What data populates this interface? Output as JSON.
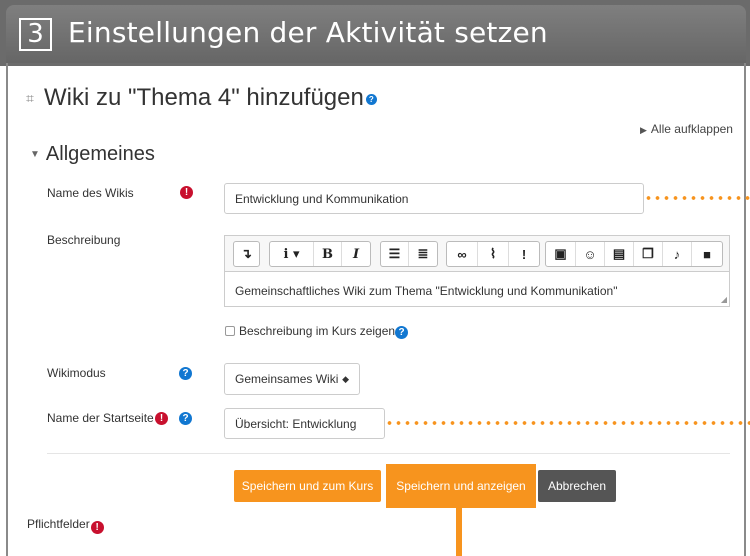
{
  "banner": {
    "step": "3",
    "title": "Einstellungen der Aktivität setzen"
  },
  "page": {
    "title": "Wiki zu \"Thema 4\" hinzufügen",
    "expand_all": "Alle aufklappen",
    "section": "Allgemeines"
  },
  "form": {
    "name": {
      "label": "Name des Wikis",
      "value": "Entwicklung und Kommunikation"
    },
    "description": {
      "label": "Beschreibung",
      "value": "Gemeinschaftliches Wiki zum Thema \"Entwicklung und Kommunikation\""
    },
    "show_description": {
      "label": "Beschreibung im Kurs zeigen",
      "checked": false
    },
    "wikimode": {
      "label": "Wikimodus",
      "value": "Gemeinsames Wiki"
    },
    "startpage": {
      "label": "Name der Startseite",
      "value": "Übersicht: Entwicklung"
    }
  },
  "toolbar": {
    "groups": [
      [
        "collapse-icon"
      ],
      [
        "info-dropdown-icon",
        "bold-icon",
        "italic-icon"
      ],
      [
        "bullet-list-icon",
        "numbered-list-icon"
      ],
      [
        "link-icon",
        "unlink-icon",
        "exclamation-icon"
      ],
      [
        "image-icon",
        "emoji-icon",
        "media-icon",
        "manage-files-icon",
        "microphone-icon",
        "video-icon"
      ]
    ]
  },
  "buttons": {
    "save_return": "Speichern und zum Kurs",
    "save_display": "Speichern und anzeigen",
    "cancel": "Abbrechen"
  },
  "footer": {
    "required": "Pflichtfelder"
  },
  "colors": {
    "accent": "#f7941e",
    "required": "#c8102e",
    "help": "#1177d1",
    "banner": "#6b6b6b"
  }
}
